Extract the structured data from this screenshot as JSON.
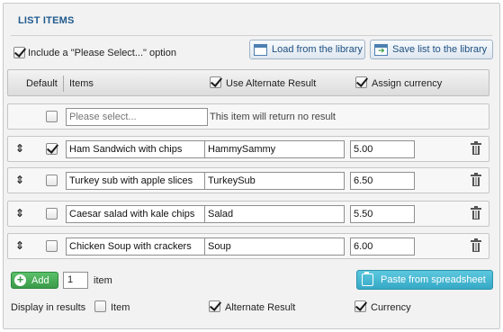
{
  "panel": {
    "title": "LIST ITEMS"
  },
  "options": {
    "include_please_select": {
      "label": "Include a \"Please Select...\" option",
      "checked": true
    }
  },
  "toolbar": {
    "load_label": "Load from the library",
    "save_label": "Save list to the library"
  },
  "header": {
    "default_label": "Default",
    "items_label": "Items",
    "use_alternate_label": "Use Alternate Result",
    "use_alternate_checked": true,
    "assign_currency_label": "Assign currency",
    "assign_currency_checked": true
  },
  "please_select_row": {
    "checked": false,
    "placeholder": "Please select...",
    "note": "This item will return no result"
  },
  "items": [
    {
      "default": true,
      "item": "Ham Sandwich with chips",
      "alternate": "HammySammy",
      "currency": "5.00"
    },
    {
      "default": false,
      "item": "Turkey sub with apple slices",
      "alternate": "TurkeySub",
      "currency": "6.50"
    },
    {
      "default": false,
      "item": "Caesar salad with kale chips",
      "alternate": "Salad",
      "currency": "5.50"
    },
    {
      "default": false,
      "item": "Chicken Soup with crackers",
      "alternate": "Soup",
      "currency": "6.00"
    }
  ],
  "footer": {
    "add_label": "Add",
    "add_quantity": "1",
    "item_label": "item",
    "paste_label": "Paste from spreadsheet",
    "display_in_results_label": "Display in results",
    "display_item": {
      "label": "Item",
      "checked": false
    },
    "display_alternate": {
      "label": "Alternate Result",
      "checked": true
    },
    "display_currency": {
      "label": "Currency",
      "checked": true
    }
  },
  "icons": {
    "drag": "drag-handle-icon",
    "delete": "trash-icon",
    "library": "library-icon",
    "add": "plus-circle-icon",
    "paste": "clipboard-icon"
  },
  "colors": {
    "title": "#1f5a8e",
    "add_button": "#3a9a48",
    "paste_button": "#36a9c6",
    "library_text": "#1d4f80"
  }
}
